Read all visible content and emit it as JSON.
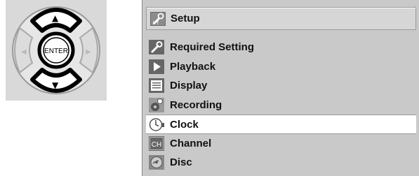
{
  "remote": {
    "enter_label": "ENTER",
    "up_arrow": "▲",
    "down_arrow": "▼",
    "left_arrow": "◀",
    "right_arrow": "▶"
  },
  "menu": {
    "title": "Setup",
    "title_icon": "setup-tools-icon",
    "items": [
      {
        "label": "Required Setting",
        "icon": "wrench-icon",
        "selected": false
      },
      {
        "label": "Playback",
        "icon": "play-icon",
        "selected": false
      },
      {
        "label": "Display",
        "icon": "display-icon",
        "selected": false
      },
      {
        "label": "Recording",
        "icon": "recording-icon",
        "selected": false
      },
      {
        "label": "Clock",
        "icon": "clock-icon",
        "selected": true
      },
      {
        "label": "Channel",
        "icon": "channel-icon",
        "selected": false
      },
      {
        "label": "Disc",
        "icon": "disc-icon",
        "selected": false
      }
    ]
  },
  "colors": {
    "panel_bg": "#c9c9c9",
    "selected_bg": "#ffffff",
    "icon_dark": "#555555",
    "remote_bg": "#d9d9d9"
  }
}
